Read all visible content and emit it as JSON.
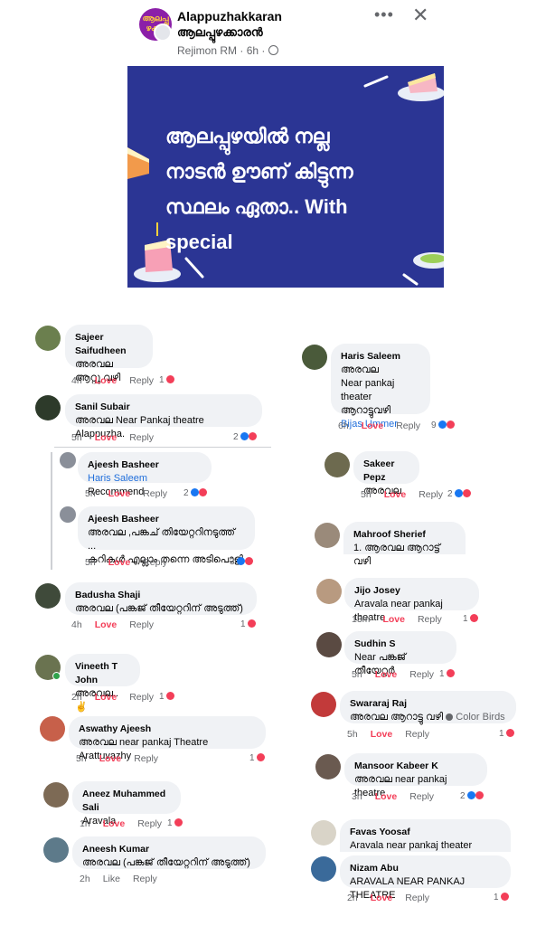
{
  "header": {
    "group_name": "Alappuzhakkaran",
    "group_name_ml": "ആലപ്പുഴക്കാരൻ",
    "author": "Rejimon RM",
    "time": "6h",
    "privacy_icon": "globe-icon",
    "avatar_text": "ആലപ്പു ഴക്കാ",
    "more_label": "•••",
    "close_label": "✕"
  },
  "banner": {
    "line1": "ആലപ്പുഴയിൽ നല്ല",
    "line2": "നാടൻ ഊണ് കിട്ടുന്ന",
    "line3": "സ്ഥലം ഏതാ.. With",
    "line4": "special",
    "bg_color": "#2b3594"
  },
  "left_comments": [
    {
      "name": "Sajeer Saifudheen",
      "text": "അരവല",
      "text2": "ആറ്റു വഴി",
      "time": "4h",
      "reaction": "Love",
      "reply": "Reply",
      "count": "1"
    },
    {
      "name": "Sanil Subair",
      "text": "അരവല Near Pankaj theatre Alappuzha.",
      "time": "5h",
      "reaction": "Love",
      "reply": "Reply",
      "count": "2"
    },
    {
      "name": "Ajeesh Basheer",
      "link": "Haris Saleem",
      "text": " Recommend",
      "time": "5h",
      "reaction": "Love",
      "reply": "Reply",
      "count": "2"
    },
    {
      "name": "Ajeesh Basheer",
      "text": "അരവല ,പങ്കച് തിയേറ്ററിനടുത്ത് ...",
      "text2": "കറികൾ എല്ലാം തന്നെ അടിപൊളി",
      "time": "5h",
      "reaction": "Love",
      "reply": "Reply",
      "count": "3"
    },
    {
      "name": "Badusha Shaji",
      "text": "അരവല (പങ്കജ് തീയേറ്ററിന് അടുത്ത്)",
      "time": "4h",
      "reaction": "Love",
      "reply": "Reply",
      "count": "1"
    },
    {
      "name": "Vineeth T John",
      "text": "അരവല.. ✌",
      "time": "2h",
      "reaction": "Love",
      "reply": "Reply",
      "count": "1"
    },
    {
      "name": "Aswathy Ajeesh",
      "text": "അരവല near pankaj Theatre Arattuvazhy",
      "time": "5h",
      "reaction": "Love",
      "reply": "Reply",
      "count": "1"
    },
    {
      "name": "Aneez Muhammed Sali",
      "text": "Aravala",
      "time": "1h",
      "reaction": "Love",
      "reply": "Reply",
      "count": "1"
    },
    {
      "name": "Aneesh Kumar",
      "text": "അരവല (പങ്കജ് തീയേറ്ററിന് അടുത്ത്)",
      "time": "2h",
      "reaction": "Like",
      "reply": "Reply",
      "count": ""
    }
  ],
  "right_comments": [
    {
      "name": "Haris Saleem",
      "text": "അരവല",
      "text2": "Near pankaj theater",
      "text3": "ആറാട്ടുവഴി",
      "link": "Bijas Ummer",
      "time": "6h",
      "reaction": "Love",
      "reply": "Reply",
      "count": "9"
    },
    {
      "name": "Sakeer Pepz",
      "text": "അരവല",
      "time": "5h",
      "reaction": "Love",
      "reply": "Reply",
      "count": "2"
    },
    {
      "name": "Mahroof Sherief",
      "text": "1. ആരവല ആറാട്ട് വഴി"
    },
    {
      "name": "Jijo Josey",
      "text": "Aravala near pankaj theatre",
      "time": "13m",
      "reaction": "Love",
      "reply": "Reply",
      "count": "1"
    },
    {
      "name": "Sudhin S",
      "text": "Near പങ്കജ് തീയേറ്റർ",
      "time": "5h",
      "reaction": "Love",
      "reply": "Reply",
      "count": "1"
    },
    {
      "name": "Swararaj Raj",
      "text": "അരവല ആറാട്ടു വഴി",
      "badge": "Color Birds",
      "time": "5h",
      "reaction": "Love",
      "reply": "Reply",
      "count": "1"
    },
    {
      "name": "Mansoor Kabeer K",
      "text": "അരവല near pankaj theatre",
      "time": "3h",
      "reaction": "Love",
      "reply": "Reply",
      "count": "2"
    },
    {
      "name": "Favas Yoosaf",
      "text": "Aravala near pankaj theater"
    },
    {
      "name": "Nizam Abu",
      "text": "ARAVALA NEAR PANKAJ THEATRE",
      "time": "2h",
      "reaction": "Love",
      "reply": "Reply",
      "count": "1"
    }
  ]
}
